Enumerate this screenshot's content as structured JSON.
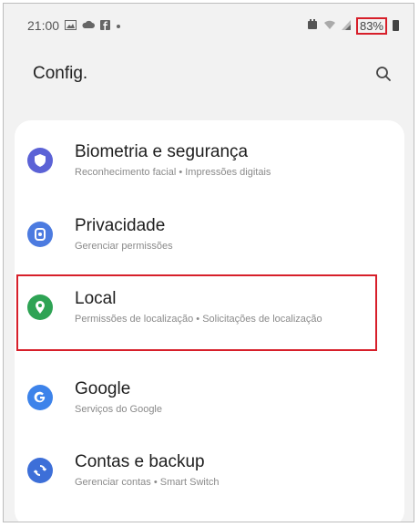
{
  "status": {
    "time": "21:00",
    "left_icons": [
      "gallery-icon",
      "cloud-icon",
      "facebook-icon",
      "dot-icon"
    ],
    "right_icons": [
      "alarm-icon",
      "wifi-icon",
      "signal-icon"
    ],
    "battery": "83%"
  },
  "header": {
    "title": "Config."
  },
  "items": [
    {
      "title": "Biometria e segurança",
      "subtitle": "Reconhecimento facial  •  Impressões digitais",
      "icon": "shield-icon",
      "color": "#5b62d6"
    },
    {
      "title": "Privacidade",
      "subtitle": "Gerenciar permissões",
      "icon": "privacy-icon",
      "color": "#4c7be0"
    },
    {
      "title": "Local",
      "subtitle": "Permissões de localização  •  Solicitações de localização",
      "icon": "location-pin-icon",
      "color": "#2ea354"
    },
    {
      "title": "Google",
      "subtitle": "Serviços do Google",
      "icon": "google-icon",
      "color": "#3d83ea"
    },
    {
      "title": "Contas e backup",
      "subtitle": "Gerenciar contas  •  Smart Switch",
      "icon": "sync-icon",
      "color": "#3d6fd8"
    }
  ],
  "colors": {
    "highlight": "#d71f2a",
    "background": "#f2f2f2"
  }
}
